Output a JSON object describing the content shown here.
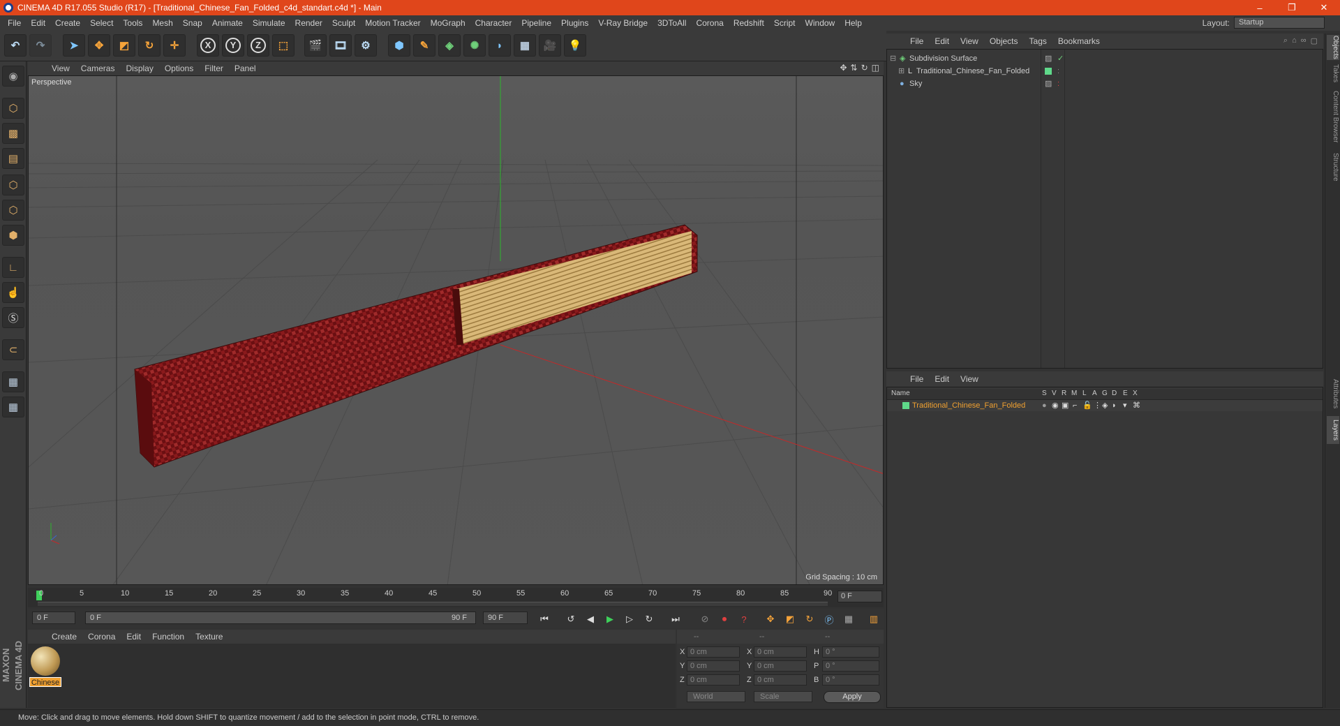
{
  "titlebar": {
    "title": "CINEMA 4D R17.055 Studio (R17) - [Traditional_Chinese_Fan_Folded_c4d_standart.c4d *] - Main",
    "min": "–",
    "max": "❐",
    "close": "✕"
  },
  "menubar": [
    "File",
    "Edit",
    "Create",
    "Select",
    "Tools",
    "Mesh",
    "Snap",
    "Animate",
    "Simulate",
    "Render",
    "Sculpt",
    "Motion Tracker",
    "MoGraph",
    "Character",
    "Pipeline",
    "Plugins",
    "V-Ray Bridge",
    "3DToAll",
    "Corona",
    "Redshift",
    "Script",
    "Window",
    "Help"
  ],
  "layout": {
    "label": "Layout:",
    "value": "Startup"
  },
  "toolbar": {
    "x": "X",
    "y": "Y",
    "z": "Z"
  },
  "viewport": {
    "menu": [
      "View",
      "Cameras",
      "Display",
      "Options",
      "Filter",
      "Panel"
    ],
    "label": "Perspective",
    "grid_spacing": "Grid Spacing : 10 cm"
  },
  "timeline": {
    "ticks": [
      "0",
      "5",
      "10",
      "15",
      "20",
      "25",
      "30",
      "35",
      "40",
      "45",
      "50",
      "55",
      "60",
      "65",
      "70",
      "75",
      "80",
      "85",
      "90"
    ],
    "frame": "0 F"
  },
  "transport": {
    "start": "0 F",
    "range_start": "0 F",
    "range_end": "90 F",
    "end": "90 F"
  },
  "material": {
    "menu": [
      "Create",
      "Corona",
      "Edit",
      "Function",
      "Texture"
    ],
    "name": "Chinese"
  },
  "coords": {
    "header": [
      "--",
      "--",
      "--"
    ],
    "x": "X",
    "y": "Y",
    "z": "Z",
    "h": "H",
    "p": "P",
    "b": "B",
    "pos_x": "0 cm",
    "pos_y": "0 cm",
    "pos_z": "0 cm",
    "size_x": "0 cm",
    "size_y": "0 cm",
    "size_z": "0 cm",
    "rot_h": "0 °",
    "rot_p": "0 °",
    "rot_b": "0 °",
    "mode1": "World",
    "mode2": "Scale",
    "apply": "Apply"
  },
  "status": "Move: Click and drag to move elements. Hold down SHIFT to quantize movement / add to the selection in point mode, CTRL to remove.",
  "objects": {
    "menu": [
      "File",
      "Edit",
      "View",
      "Objects",
      "Tags",
      "Bookmarks"
    ],
    "items": [
      "Subdivision Surface",
      "Traditional_Chinese_Fan_Folded",
      "Sky"
    ]
  },
  "layers": {
    "menu": [
      "File",
      "Edit",
      "View"
    ],
    "columns": [
      "Name",
      "S",
      "V",
      "R",
      "M",
      "L",
      "A",
      "G",
      "D",
      "E",
      "X"
    ],
    "row": "Traditional_Chinese_Fan_Folded",
    "row_color": "#5fd98a"
  },
  "right_tabs": [
    "Objects",
    "Takes",
    "Content Browser",
    "Structure",
    "Attributes",
    "Layers"
  ],
  "logo": "MAXON CINEMA 4D",
  "colors": {
    "title": "#e0461b",
    "material_label": "#f0a030",
    "layer_text": "#f0a030"
  }
}
